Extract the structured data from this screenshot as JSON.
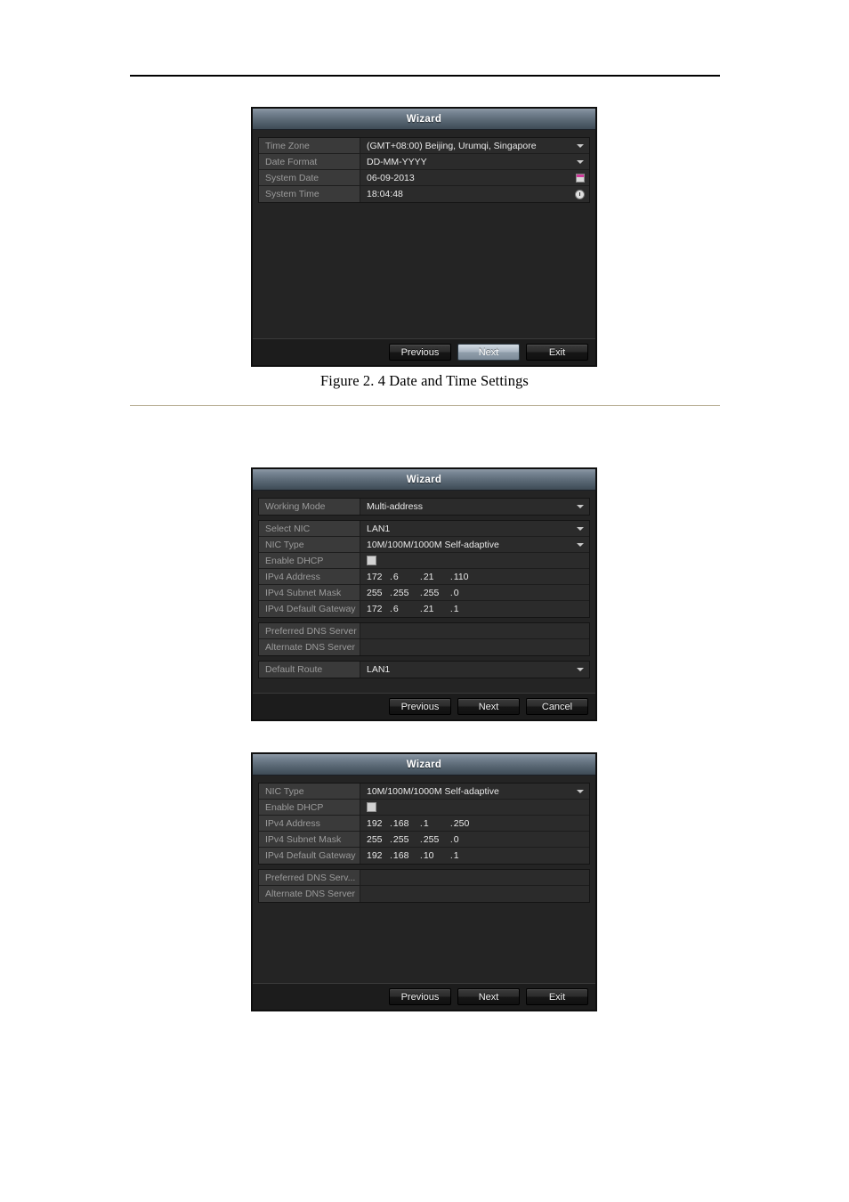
{
  "page": {
    "caption_1": "Figure 2. 4 Date and Time Settings"
  },
  "dialog_datetime": {
    "title": "Wizard",
    "rows": [
      {
        "label": "Time Zone",
        "value": "(GMT+08:00) Beijing, Urumqi, Singapore",
        "control": "dropdown"
      },
      {
        "label": "Date Format",
        "value": "DD-MM-YYYY",
        "control": "dropdown"
      },
      {
        "label": "System Date",
        "value": "06-09-2013",
        "control": "calendar-icon"
      },
      {
        "label": "System Time",
        "value": "18:04:48",
        "control": "clock-icon"
      }
    ],
    "buttons": [
      {
        "label": "Previous",
        "state": "normal"
      },
      {
        "label": "Next",
        "state": "active"
      },
      {
        "label": "Exit",
        "state": "normal"
      }
    ]
  },
  "dialog_network_multi": {
    "title": "Wizard",
    "group1": [
      {
        "label": "Working Mode",
        "value": "Multi-address",
        "control": "dropdown"
      }
    ],
    "group2": [
      {
        "label": "Select NIC",
        "value": "LAN1",
        "control": "dropdown"
      },
      {
        "label": "NIC Type",
        "value": "10M/100M/1000M Self-adaptive",
        "control": "dropdown"
      },
      {
        "label": "Enable DHCP",
        "value": "",
        "control": "checkbox",
        "checked": false
      },
      {
        "label": "IPv4 Address",
        "control": "ip",
        "octets": [
          "172",
          "6",
          "21",
          "110"
        ]
      },
      {
        "label": "IPv4 Subnet Mask",
        "control": "ip",
        "octets": [
          "255",
          "255",
          "255",
          "0"
        ]
      },
      {
        "label": "IPv4 Default Gateway",
        "control": "ip",
        "octets": [
          "172",
          "6",
          "21",
          "1"
        ]
      }
    ],
    "group3": [
      {
        "label": "Preferred DNS Server",
        "value": "",
        "control": "text"
      },
      {
        "label": "Alternate DNS Server",
        "value": "",
        "control": "text"
      }
    ],
    "group4": [
      {
        "label": "Default Route",
        "value": "LAN1",
        "control": "dropdown"
      }
    ],
    "buttons": [
      {
        "label": "Previous",
        "state": "normal"
      },
      {
        "label": "Next",
        "state": "normal"
      },
      {
        "label": "Cancel",
        "state": "normal"
      }
    ]
  },
  "dialog_network_single": {
    "title": "Wizard",
    "group1": [
      {
        "label": "NIC Type",
        "value": "10M/100M/1000M Self-adaptive",
        "control": "dropdown"
      },
      {
        "label": "Enable DHCP",
        "value": "",
        "control": "checkbox",
        "checked": false
      },
      {
        "label": "IPv4 Address",
        "control": "ip",
        "octets": [
          "192",
          "168",
          "1",
          "250"
        ]
      },
      {
        "label": "IPv4 Subnet Mask",
        "control": "ip",
        "octets": [
          "255",
          "255",
          "255",
          "0"
        ]
      },
      {
        "label": "IPv4 Default Gateway",
        "control": "ip",
        "octets": [
          "192",
          "168",
          "10",
          "1"
        ]
      }
    ],
    "group2": [
      {
        "label": "Preferred DNS Serv...",
        "value": "",
        "control": "text"
      },
      {
        "label": "Alternate DNS Server",
        "value": "",
        "control": "text"
      }
    ],
    "buttons": [
      {
        "label": "Previous",
        "state": "normal"
      },
      {
        "label": "Next",
        "state": "normal"
      },
      {
        "label": "Exit",
        "state": "normal"
      }
    ]
  }
}
